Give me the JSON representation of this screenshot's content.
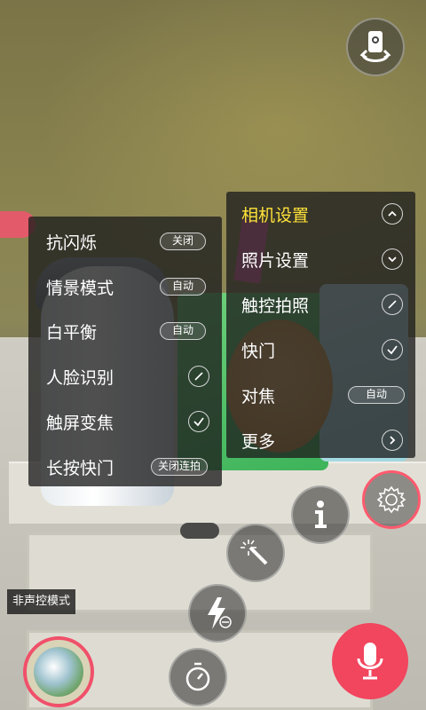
{
  "left_menu": {
    "items": [
      {
        "label": "抗闪烁",
        "control": "pill",
        "value": "关闭"
      },
      {
        "label": "情景模式",
        "control": "pill",
        "value": "自动"
      },
      {
        "label": "白平衡",
        "control": "pill",
        "value": "自动"
      },
      {
        "label": "人脸识别",
        "control": "toggle",
        "state": "off"
      },
      {
        "label": "触屏变焦",
        "control": "toggle",
        "state": "on"
      },
      {
        "label": "长按快门",
        "control": "pill",
        "value": "关闭连拍"
      }
    ]
  },
  "right_menu": {
    "items": [
      {
        "label": "相机设置",
        "control": "chevron-up",
        "active": true
      },
      {
        "label": "照片设置",
        "control": "chevron-down"
      },
      {
        "label": "触控拍照",
        "control": "toggle",
        "state": "off"
      },
      {
        "label": "快门",
        "control": "toggle",
        "state": "on"
      },
      {
        "label": "对焦",
        "control": "pill",
        "value": "自动"
      },
      {
        "label": "更多",
        "control": "chevron-right"
      }
    ],
    "active_color": "#ffe23a"
  },
  "voice_mode_label": "非声控模式",
  "colors": {
    "accent": "#f2455e",
    "panel_bg": "rgba(30,30,30,0.78)"
  },
  "icons": {
    "rotate": "switch-camera-icon",
    "info": "info-icon",
    "settings": "gear-icon",
    "effects": "magic-wand-icon",
    "flash": "flash-auto-icon",
    "timer": "timer-icon",
    "mic": "microphone-icon"
  }
}
